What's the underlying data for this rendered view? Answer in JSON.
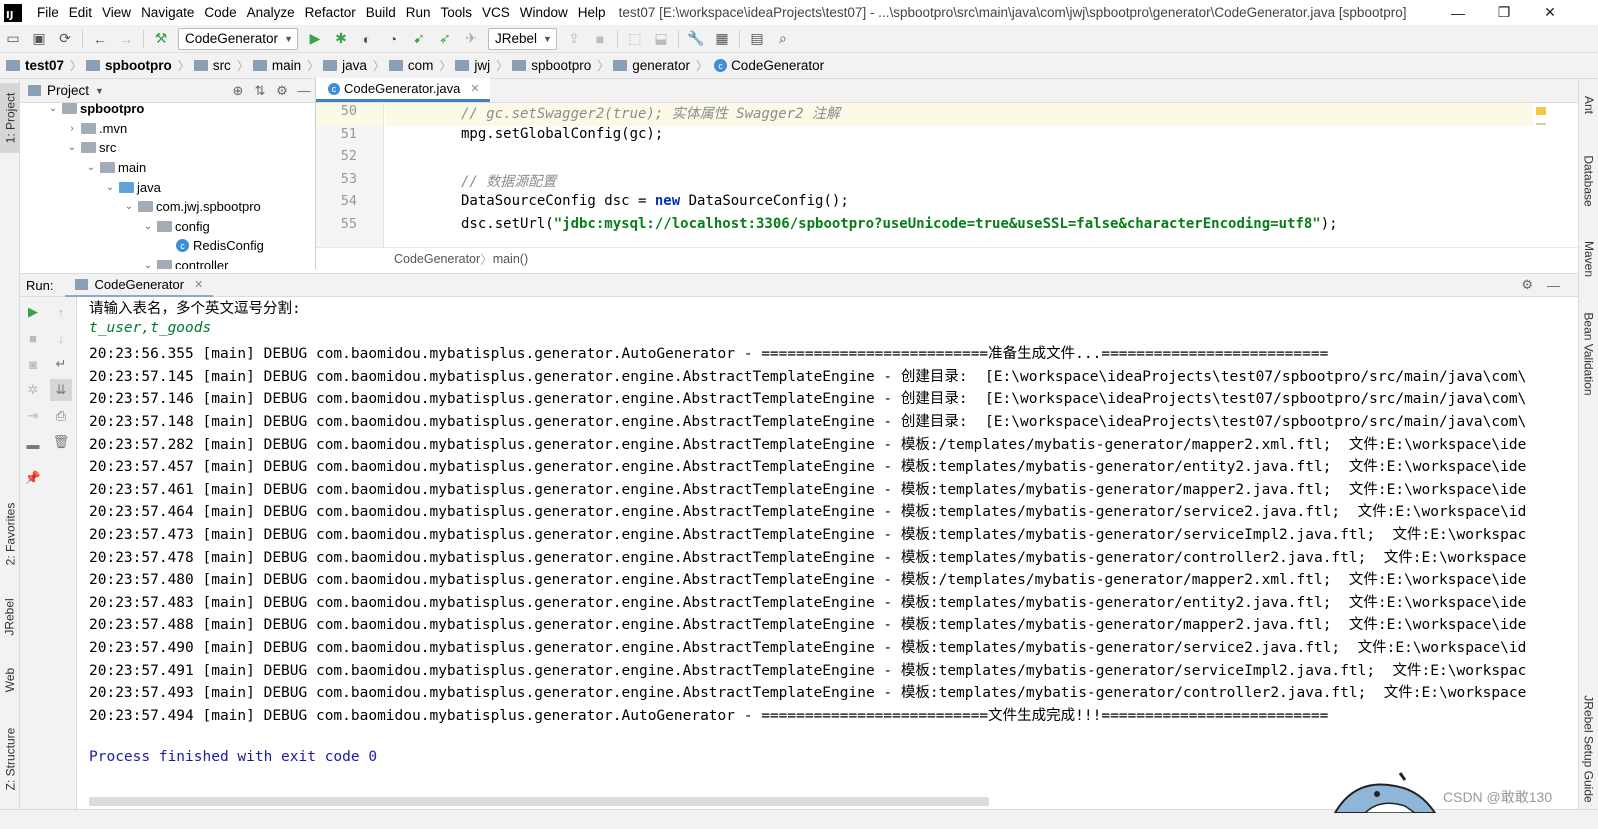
{
  "app": {
    "logo_text": "IJ",
    "menu": [
      "File",
      "Edit",
      "View",
      "Navigate",
      "Code",
      "Analyze",
      "Refactor",
      "Build",
      "Run",
      "Tools",
      "VCS",
      "Window",
      "Help"
    ],
    "window_title": "test07 [E:\\workspace\\ideaProjects\\test07] - ...\\spbootpro\\src\\main\\java\\com\\jwj\\spbootpro\\generator\\CodeGenerator.java [spbootpro]"
  },
  "toolbar": {
    "run_config": "CodeGenerator",
    "jrebel": "JRebel"
  },
  "breadcrumb": [
    "test07",
    "spbootpro",
    "src",
    "main",
    "java",
    "com",
    "jwj",
    "spbootpro",
    "generator",
    "CodeGenerator"
  ],
  "left_stripe": {
    "project": "1: Project",
    "favorites": "2: Favorites",
    "jrebel": "JRebel",
    "web": "Web",
    "structure": "Z: Structure"
  },
  "right_stripe": {
    "ant": "Ant",
    "database": "Database",
    "maven": "Maven",
    "bean_validation": "Bean Validation",
    "jrebel_setup": "JRebel Setup Guide"
  },
  "project_panel": {
    "title": "Project",
    "tree": [
      {
        "label": "spbootpro",
        "depth": 0,
        "chev": "v",
        "kind": "module"
      },
      {
        "label": ".mvn",
        "depth": 1,
        "chev": ">",
        "kind": "folder"
      },
      {
        "label": "src",
        "depth": 1,
        "chev": "v",
        "kind": "folder"
      },
      {
        "label": "main",
        "depth": 2,
        "chev": "v",
        "kind": "folder"
      },
      {
        "label": "java",
        "depth": 3,
        "chev": "v",
        "kind": "source"
      },
      {
        "label": "com.jwj.spbootpro",
        "depth": 4,
        "chev": "v",
        "kind": "folder"
      },
      {
        "label": "config",
        "depth": 5,
        "chev": "v",
        "kind": "folder"
      },
      {
        "label": "RedisConfig",
        "depth": 6,
        "chev": "",
        "kind": "class"
      },
      {
        "label": "controller",
        "depth": 5,
        "chev": "v",
        "kind": "folder"
      }
    ]
  },
  "editor": {
    "tab": "CodeGenerator.java",
    "lines": [
      {
        "n": "50",
        "segments": [
          {
            "t": "// gc.setSwagger2(true); 实体属性 Swagger2 注解",
            "c": "cmt"
          }
        ],
        "hl": true
      },
      {
        "n": "51",
        "segments": [
          {
            "t": "mpg.setGlobalConfig(gc);",
            "c": ""
          }
        ]
      },
      {
        "n": "52",
        "segments": []
      },
      {
        "n": "53",
        "segments": [
          {
            "t": "// 数据源配置",
            "c": "cmt"
          }
        ]
      },
      {
        "n": "54",
        "segments": [
          {
            "t": "DataSourceConfig dsc = ",
            "c": ""
          },
          {
            "t": "new",
            "c": "kw"
          },
          {
            "t": " DataSourceConfig();",
            "c": ""
          }
        ]
      },
      {
        "n": "55",
        "segments": [
          {
            "t": "dsc.setUrl(",
            "c": ""
          },
          {
            "t": "\"jdbc:mysql://localhost:3306/spbootpro?useUnicode=true&useSSL=false&characterEncoding=utf8\"",
            "c": "str"
          },
          {
            "t": ");",
            "c": ""
          }
        ]
      }
    ],
    "crumb": [
      "CodeGenerator",
      "main()"
    ]
  },
  "run": {
    "label": "Run:",
    "tab": "CodeGenerator",
    "console": [
      {
        "t": "请输入表名，多个英文逗号分割:",
        "c": ""
      },
      {
        "t": "t_user,t_goods",
        "c": "con-in"
      },
      {
        "t": "20:23:56.355 [main] DEBUG com.baomidou.mybatisplus.generator.AutoGenerator - ==========================准备生成文件...==========================",
        "c": ""
      },
      {
        "t": "20:23:57.145 [main] DEBUG com.baomidou.mybatisplus.generator.engine.AbstractTemplateEngine - 创建目录:  [E:\\workspace\\ideaProjects\\test07/spbootpro/src/main/java\\com\\",
        "c": ""
      },
      {
        "t": "20:23:57.146 [main] DEBUG com.baomidou.mybatisplus.generator.engine.AbstractTemplateEngine - 创建目录:  [E:\\workspace\\ideaProjects\\test07/spbootpro/src/main/java\\com\\",
        "c": ""
      },
      {
        "t": "20:23:57.148 [main] DEBUG com.baomidou.mybatisplus.generator.engine.AbstractTemplateEngine - 创建目录:  [E:\\workspace\\ideaProjects\\test07/spbootpro/src/main/java\\com\\",
        "c": ""
      },
      {
        "t": "20:23:57.282 [main] DEBUG com.baomidou.mybatisplus.generator.engine.AbstractTemplateEngine - 模板:/templates/mybatis-generator/mapper2.xml.ftl;  文件:E:\\workspace\\ide",
        "c": ""
      },
      {
        "t": "20:23:57.457 [main] DEBUG com.baomidou.mybatisplus.generator.engine.AbstractTemplateEngine - 模板:templates/mybatis-generator/entity2.java.ftl;  文件:E:\\workspace\\ide",
        "c": ""
      },
      {
        "t": "20:23:57.461 [main] DEBUG com.baomidou.mybatisplus.generator.engine.AbstractTemplateEngine - 模板:templates/mybatis-generator/mapper2.java.ftl;  文件:E:\\workspace\\ide",
        "c": ""
      },
      {
        "t": "20:23:57.464 [main] DEBUG com.baomidou.mybatisplus.generator.engine.AbstractTemplateEngine - 模板:templates/mybatis-generator/service2.java.ftl;  文件:E:\\workspace\\id",
        "c": ""
      },
      {
        "t": "20:23:57.473 [main] DEBUG com.baomidou.mybatisplus.generator.engine.AbstractTemplateEngine - 模板:templates/mybatis-generator/serviceImpl2.java.ftl;  文件:E:\\workspac",
        "c": ""
      },
      {
        "t": "20:23:57.478 [main] DEBUG com.baomidou.mybatisplus.generator.engine.AbstractTemplateEngine - 模板:templates/mybatis-generator/controller2.java.ftl;  文件:E:\\workspace",
        "c": ""
      },
      {
        "t": "20:23:57.480 [main] DEBUG com.baomidou.mybatisplus.generator.engine.AbstractTemplateEngine - 模板:/templates/mybatis-generator/mapper2.xml.ftl;  文件:E:\\workspace\\ide",
        "c": ""
      },
      {
        "t": "20:23:57.483 [main] DEBUG com.baomidou.mybatisplus.generator.engine.AbstractTemplateEngine - 模板:templates/mybatis-generator/entity2.java.ftl;  文件:E:\\workspace\\ide",
        "c": ""
      },
      {
        "t": "20:23:57.488 [main] DEBUG com.baomidou.mybatisplus.generator.engine.AbstractTemplateEngine - 模板:templates/mybatis-generator/mapper2.java.ftl;  文件:E:\\workspace\\ide",
        "c": ""
      },
      {
        "t": "20:23:57.490 [main] DEBUG com.baomidou.mybatisplus.generator.engine.AbstractTemplateEngine - 模板:templates/mybatis-generator/service2.java.ftl;  文件:E:\\workspace\\id",
        "c": ""
      },
      {
        "t": "20:23:57.491 [main] DEBUG com.baomidou.mybatisplus.generator.engine.AbstractTemplateEngine - 模板:templates/mybatis-generator/serviceImpl2.java.ftl;  文件:E:\\workspac",
        "c": ""
      },
      {
        "t": "20:23:57.493 [main] DEBUG com.baomidou.mybatisplus.generator.engine.AbstractTemplateEngine - 模板:templates/mybatis-generator/controller2.java.ftl;  文件:E:\\workspace",
        "c": ""
      },
      {
        "t": "20:23:57.494 [main] DEBUG com.baomidou.mybatisplus.generator.AutoGenerator - ==========================文件生成完成!!!==========================",
        "c": ""
      },
      {
        "t": "",
        "c": ""
      },
      {
        "t": "Process finished with exit code 0",
        "c": "con-done"
      }
    ]
  },
  "watermark": "CSDN @敢敢130",
  "colors": {
    "accent": "#4083c9",
    "run_green": "#3aa24b",
    "highlight": "#fcfae7"
  }
}
